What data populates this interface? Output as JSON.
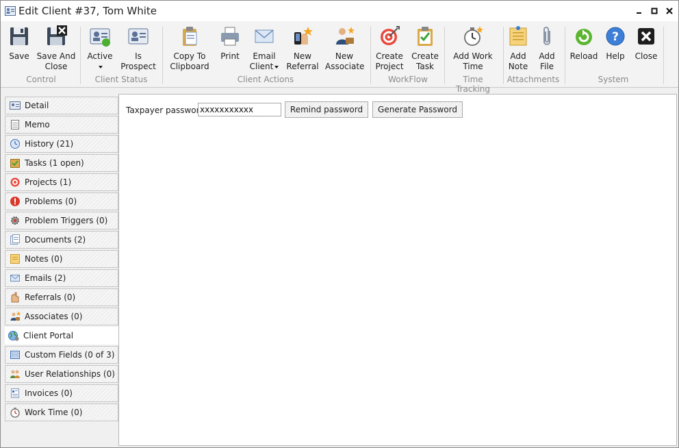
{
  "window": {
    "title": "Edit Client #37, Tom White",
    "icons": [
      "app-client-icon",
      "minimize-icon",
      "maximize-icon",
      "close-window-icon"
    ]
  },
  "ribbon": {
    "buttons": {
      "save": {
        "label": "Save",
        "icon": "floppy-disk-icon"
      },
      "save_close": {
        "label": "Save And\nClose",
        "icon": "floppy-disk-close-icon"
      },
      "active": {
        "label": "Active",
        "icon": "client-card-green-icon"
      },
      "is_prospect": {
        "label": "Is\nProspect",
        "icon": "client-card-icon"
      },
      "copy_clipboard": {
        "label": "Copy To\nClipboard",
        "icon": "clipboard-icon"
      },
      "print": {
        "label": "Print",
        "icon": "printer-icon"
      },
      "email_client": {
        "label": "Email\nClient",
        "icon": "envelope-icon"
      },
      "new_referral": {
        "label": "New\nReferral",
        "icon": "referral-icon"
      },
      "new_associate": {
        "label": "New\nAssociate",
        "icon": "associate-icon"
      },
      "create_project": {
        "label": "Create\nProject",
        "icon": "target-icon"
      },
      "create_task": {
        "label": "Create\nTask",
        "icon": "checklist-icon"
      },
      "add_work_time": {
        "label": "Add Work\nTime",
        "icon": "stopwatch-icon"
      },
      "add_note": {
        "label": "Add\nNote",
        "icon": "note-icon"
      },
      "add_file": {
        "label": "Add\nFile",
        "icon": "paperclip-icon"
      },
      "reload": {
        "label": "Reload",
        "icon": "reload-icon"
      },
      "help": {
        "label": "Help",
        "icon": "help-icon"
      },
      "close": {
        "label": "Close",
        "icon": "close-icon"
      }
    },
    "groups": {
      "control": "Control",
      "client_status": "Client Status",
      "client_actions": "Client Actions",
      "workflow": "WorkFlow",
      "time_tracking": "Time Tracking",
      "attachments": "Attachments",
      "system": "System"
    }
  },
  "sidebar": {
    "items": [
      {
        "label": "Detail",
        "icon": "detail-card-icon"
      },
      {
        "label": "Memo",
        "icon": "memo-icon"
      },
      {
        "label": "History (21)",
        "icon": "history-icon"
      },
      {
        "label": "Tasks (1 open)",
        "icon": "tasks-icon"
      },
      {
        "label": "Projects (1)",
        "icon": "projects-icon"
      },
      {
        "label": "Problems (0)",
        "icon": "problems-icon"
      },
      {
        "label": "Problem Triggers (0)",
        "icon": "problem-triggers-icon"
      },
      {
        "label": "Documents (2)",
        "icon": "documents-icon"
      },
      {
        "label": "Notes (0)",
        "icon": "notes-icon"
      },
      {
        "label": "Emails (2)",
        "icon": "emails-icon"
      },
      {
        "label": "Referrals (0)",
        "icon": "referrals-icon"
      },
      {
        "label": "Associates (0)",
        "icon": "associates-icon"
      },
      {
        "label": "Client Portal",
        "icon": "client-portal-icon",
        "active": true
      },
      {
        "label": "Custom Fields (0 of 3)",
        "icon": "custom-fields-icon"
      },
      {
        "label": "User Relationships (0)",
        "icon": "user-relationships-icon"
      },
      {
        "label": "Invoices (0)",
        "icon": "invoices-icon"
      },
      {
        "label": "Work Time (0)",
        "icon": "work-time-icon"
      }
    ]
  },
  "portal": {
    "password_label": "Taxpayer password:",
    "password_value": "xxxxxxxxxxx",
    "remind_button": "Remind password",
    "generate_button": "Generate Password"
  }
}
